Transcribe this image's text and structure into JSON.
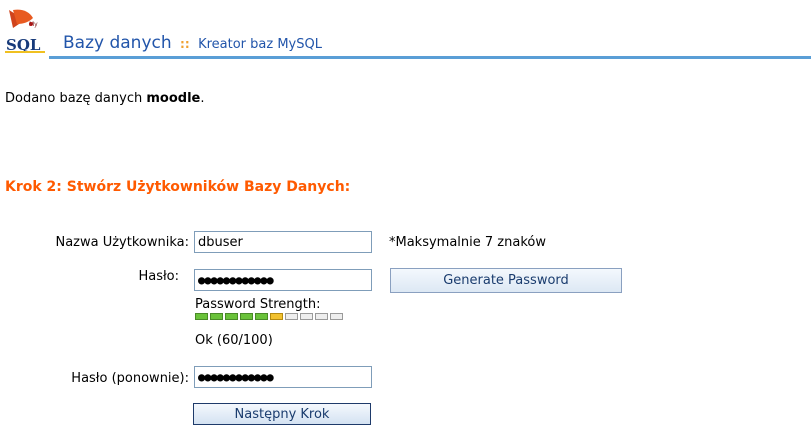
{
  "header": {
    "logo_text": "SQL",
    "title": "Bazy danych",
    "separator": "::",
    "subtitle": "Kreator baz MySQL"
  },
  "status": {
    "prefix": "Dodano bazę danych ",
    "db_name": "moodle",
    "suffix": "."
  },
  "step": {
    "title": "Krok 2: Stwórz Użytkowników Bazy Danych:"
  },
  "form": {
    "username_label": "Nazwa Użytkownika:",
    "username_value": "dbuser",
    "username_hint": "*Maksymalnie 7 znaków",
    "password_label": "Hasło:",
    "password_value": "●●●●●●●●●●●●",
    "generate_button": "Generate Password",
    "strength_label": "Password Strength:",
    "strength_score": 60,
    "strength_segments_filled": 6,
    "strength_segments_total": 10,
    "strength_value": "Ok (60/100)",
    "password_confirm_label": "Hasło (ponownie):",
    "password_confirm_value": "●●●●●●●●●●●●",
    "next_button": "Następny Krok"
  },
  "colors": {
    "accent_blue": "#2255aa",
    "header_line": "#5a9ed6",
    "step_orange": "#ff5a00",
    "strength_green": "#6ac23a",
    "strength_yellow": "#f2c12e"
  }
}
